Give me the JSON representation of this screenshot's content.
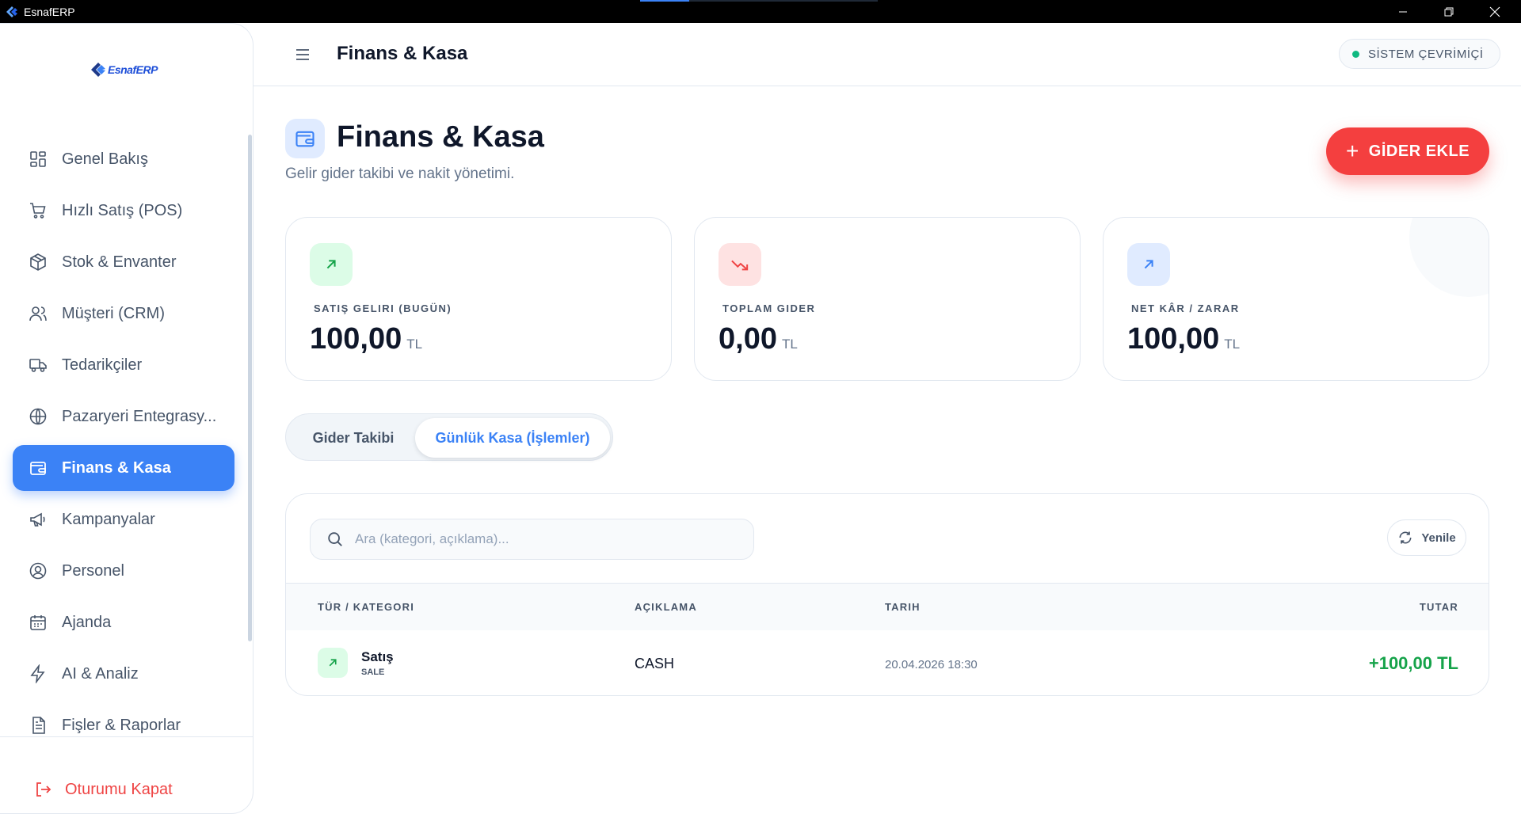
{
  "window": {
    "title": "EsnafERP"
  },
  "brand": {
    "logo_text": "EsnafERP"
  },
  "sidebar": {
    "items": [
      {
        "label": "Genel Bakış"
      },
      {
        "label": "Hızlı Satış (POS)"
      },
      {
        "label": "Stok & Envanter"
      },
      {
        "label": "Müşteri (CRM)"
      },
      {
        "label": "Tedarikçiler"
      },
      {
        "label": "Pazaryeri Entegrasy..."
      },
      {
        "label": "Finans & Kasa"
      },
      {
        "label": "Kampanyalar"
      },
      {
        "label": "Personel"
      },
      {
        "label": "Ajanda"
      },
      {
        "label": "AI & Analiz"
      },
      {
        "label": "Fişler & Raporlar"
      }
    ],
    "active_index": 6,
    "logout_label": "Oturumu Kapat"
  },
  "header": {
    "title": "Finans & Kasa",
    "status_label": "SİSTEM ÇEVRİMİÇİ"
  },
  "page": {
    "title": "Finans & Kasa",
    "subtitle": "Gelir gider takibi ve nakit yönetimi.",
    "add_button_label": "GİDER EKLE"
  },
  "stats": [
    {
      "label": "SATIŞ GELIRI (BUGÜN)",
      "value": "100,00",
      "currency": "TL",
      "accent": "#16a34a"
    },
    {
      "label": "TOPLAM GIDER",
      "value": "0,00",
      "currency": "TL",
      "accent": "#ef4444"
    },
    {
      "label": "NET KÂR / ZARAR",
      "value": "100,00",
      "currency": "TL",
      "accent": "#3b82f6"
    }
  ],
  "tabs": [
    {
      "label": "Gider Takibi",
      "active": false
    },
    {
      "label": "Günlük Kasa (İşlemler)",
      "active": true
    }
  ],
  "search": {
    "placeholder": "Ara (kategori, açıklama)...",
    "value": ""
  },
  "refresh_label": "Yenile",
  "table": {
    "headers": {
      "category": "TÜR / KATEGORI",
      "description": "AÇIKLAMA",
      "date": "TARIH",
      "amount": "TUTAR"
    },
    "rows": [
      {
        "category": "Satış",
        "type": "SALE",
        "description": "CASH",
        "date": "20.04.2026 18:30",
        "amount": "+100,00 TL"
      }
    ]
  },
  "colors": {
    "primary": "#3b82f6",
    "danger": "#f43f3f",
    "success": "#16a34a",
    "online": "#10b981"
  }
}
